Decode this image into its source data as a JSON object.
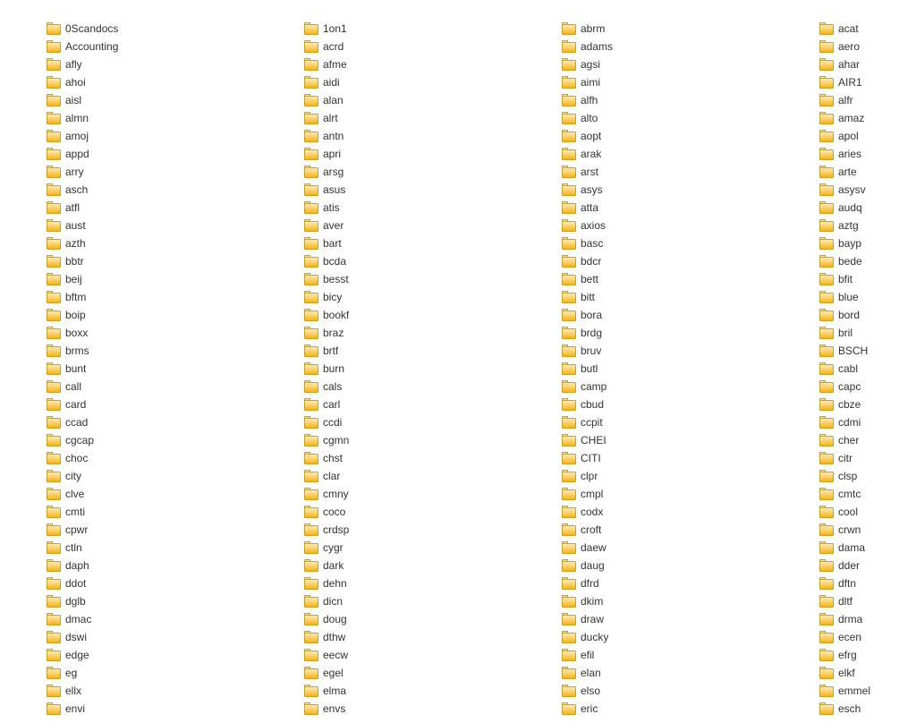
{
  "view": "file-explorer-list",
  "item_type": "folder",
  "columns": [
    {
      "items": [
        {
          "name": "0Scandocs"
        },
        {
          "name": "Accounting"
        },
        {
          "name": "afly"
        },
        {
          "name": "ahoi"
        },
        {
          "name": "aisl"
        },
        {
          "name": "almn"
        },
        {
          "name": "amoj"
        },
        {
          "name": "appd"
        },
        {
          "name": "arry"
        },
        {
          "name": "asch"
        },
        {
          "name": "atfl"
        },
        {
          "name": "aust"
        },
        {
          "name": "azth"
        },
        {
          "name": "bbtr"
        },
        {
          "name": "beij"
        },
        {
          "name": "bftm"
        },
        {
          "name": "boip"
        },
        {
          "name": "boxx"
        },
        {
          "name": "brms"
        },
        {
          "name": "bunt"
        },
        {
          "name": "call"
        },
        {
          "name": "card"
        },
        {
          "name": "ccad"
        },
        {
          "name": "cgcap"
        },
        {
          "name": "choc"
        },
        {
          "name": "city"
        },
        {
          "name": "clve"
        },
        {
          "name": "cmti"
        },
        {
          "name": "cpwr"
        },
        {
          "name": "ctln"
        },
        {
          "name": "daph"
        },
        {
          "name": "ddot"
        },
        {
          "name": "dglb"
        },
        {
          "name": "dmac"
        },
        {
          "name": "dswi"
        },
        {
          "name": "edge"
        },
        {
          "name": "eg"
        },
        {
          "name": "ellx"
        },
        {
          "name": "envi"
        }
      ]
    },
    {
      "items": [
        {
          "name": "1on1"
        },
        {
          "name": "acrd"
        },
        {
          "name": "afme"
        },
        {
          "name": "aidi"
        },
        {
          "name": "alan"
        },
        {
          "name": "alrt"
        },
        {
          "name": "antn"
        },
        {
          "name": "apri"
        },
        {
          "name": "arsg"
        },
        {
          "name": "asus"
        },
        {
          "name": "atis"
        },
        {
          "name": "aver"
        },
        {
          "name": "bart"
        },
        {
          "name": "bcda"
        },
        {
          "name": "besst"
        },
        {
          "name": "bicy"
        },
        {
          "name": "bookf"
        },
        {
          "name": "braz"
        },
        {
          "name": "brtf"
        },
        {
          "name": "burn"
        },
        {
          "name": "cals"
        },
        {
          "name": "carl"
        },
        {
          "name": "ccdi"
        },
        {
          "name": "cgmn"
        },
        {
          "name": "chst"
        },
        {
          "name": "clar"
        },
        {
          "name": "cmny"
        },
        {
          "name": "coco"
        },
        {
          "name": "crdsp"
        },
        {
          "name": "cygr"
        },
        {
          "name": "dark"
        },
        {
          "name": "dehn"
        },
        {
          "name": "dicn"
        },
        {
          "name": "doug"
        },
        {
          "name": "dthw"
        },
        {
          "name": "eecw"
        },
        {
          "name": "egel"
        },
        {
          "name": "elma"
        },
        {
          "name": "envs"
        }
      ]
    },
    {
      "items": [
        {
          "name": "abrm"
        },
        {
          "name": "adams"
        },
        {
          "name": "agsi"
        },
        {
          "name": "aimi"
        },
        {
          "name": "alfh"
        },
        {
          "name": "alto"
        },
        {
          "name": "aopt"
        },
        {
          "name": "arak"
        },
        {
          "name": "arst"
        },
        {
          "name": "asys"
        },
        {
          "name": "atta"
        },
        {
          "name": "axios"
        },
        {
          "name": "basc"
        },
        {
          "name": "bdcr"
        },
        {
          "name": "bett"
        },
        {
          "name": "bitt"
        },
        {
          "name": "bora"
        },
        {
          "name": "brdg"
        },
        {
          "name": "bruv"
        },
        {
          "name": "butl"
        },
        {
          "name": "camp"
        },
        {
          "name": "cbud"
        },
        {
          "name": "ccpit"
        },
        {
          "name": "CHEI"
        },
        {
          "name": "CITI"
        },
        {
          "name": "clpr"
        },
        {
          "name": "cmpl"
        },
        {
          "name": "codx"
        },
        {
          "name": "croft"
        },
        {
          "name": "daew"
        },
        {
          "name": "daug"
        },
        {
          "name": "dfrd"
        },
        {
          "name": "dkim"
        },
        {
          "name": "draw"
        },
        {
          "name": "ducky"
        },
        {
          "name": "efil"
        },
        {
          "name": "elan"
        },
        {
          "name": "elso"
        },
        {
          "name": "eric"
        }
      ]
    },
    {
      "items": [
        {
          "name": "acat"
        },
        {
          "name": "aero"
        },
        {
          "name": "ahar"
        },
        {
          "name": "AIR1"
        },
        {
          "name": "alfr"
        },
        {
          "name": "amaz"
        },
        {
          "name": "apol"
        },
        {
          "name": "aries"
        },
        {
          "name": "arte"
        },
        {
          "name": "asysv"
        },
        {
          "name": "audq"
        },
        {
          "name": "aztg"
        },
        {
          "name": "bayp"
        },
        {
          "name": "bede"
        },
        {
          "name": "bfit"
        },
        {
          "name": "blue"
        },
        {
          "name": "bord"
        },
        {
          "name": "bril"
        },
        {
          "name": "BSCH"
        },
        {
          "name": "cabl"
        },
        {
          "name": "capc"
        },
        {
          "name": "cbze"
        },
        {
          "name": "cdmi"
        },
        {
          "name": "cher"
        },
        {
          "name": "citr"
        },
        {
          "name": "clsp"
        },
        {
          "name": "cmtc"
        },
        {
          "name": "cool"
        },
        {
          "name": "crwn"
        },
        {
          "name": "dama"
        },
        {
          "name": "dder"
        },
        {
          "name": "dftn"
        },
        {
          "name": "dltf"
        },
        {
          "name": "drma"
        },
        {
          "name": "ecen"
        },
        {
          "name": "efrg"
        },
        {
          "name": "elkf"
        },
        {
          "name": "emmel"
        },
        {
          "name": "esch"
        }
      ]
    }
  ]
}
